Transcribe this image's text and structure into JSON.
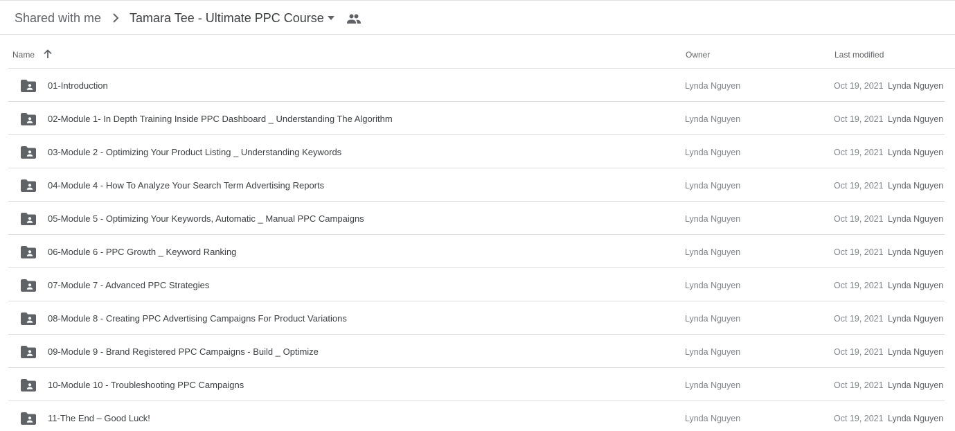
{
  "breadcrumb": {
    "root": "Shared with me",
    "current": "Tamara Tee - Ultimate PPC Course"
  },
  "columns": {
    "name": "Name",
    "owner": "Owner",
    "last_modified": "Last modified"
  },
  "colors": {
    "icon": "#5f6368",
    "divider": "#dadce0",
    "text": "#3c4043",
    "muted": "#80868b"
  },
  "icons": {
    "folder": "shared-folder-icon",
    "sort": "arrow-up-icon",
    "separator": "chevron-right-icon",
    "dropdown": "caret-down-icon",
    "shared": "people-icon"
  },
  "files": [
    {
      "name": "01-Introduction",
      "owner": "Lynda Nguyen",
      "date": "Oct 19, 2021",
      "by": "Lynda Nguyen"
    },
    {
      "name": "02-Module 1- In Depth Training Inside PPC Dashboard _ Understanding The Algorithm",
      "owner": "Lynda Nguyen",
      "date": "Oct 19, 2021",
      "by": "Lynda Nguyen"
    },
    {
      "name": "03-Module 2 - Optimizing Your Product Listing _ Understanding Keywords",
      "owner": "Lynda Nguyen",
      "date": "Oct 19, 2021",
      "by": "Lynda Nguyen"
    },
    {
      "name": "04-Module 4 - How To Analyze Your Search Term Advertising Reports",
      "owner": "Lynda Nguyen",
      "date": "Oct 19, 2021",
      "by": "Lynda Nguyen"
    },
    {
      "name": "05-Module 5 - Optimizing Your Keywords, Automatic _ Manual PPC Campaigns",
      "owner": "Lynda Nguyen",
      "date": "Oct 19, 2021",
      "by": "Lynda Nguyen"
    },
    {
      "name": "06-Module 6 - PPC Growth _ Keyword Ranking",
      "owner": "Lynda Nguyen",
      "date": "Oct 19, 2021",
      "by": "Lynda Nguyen"
    },
    {
      "name": "07-Module 7 - Advanced PPC Strategies",
      "owner": "Lynda Nguyen",
      "date": "Oct 19, 2021",
      "by": "Lynda Nguyen"
    },
    {
      "name": "08-Module 8 - Creating PPC Advertising Campaigns For Product Variations",
      "owner": "Lynda Nguyen",
      "date": "Oct 19, 2021",
      "by": "Lynda Nguyen"
    },
    {
      "name": "09-Module 9 - Brand Registered PPC Campaigns - Build _ Optimize",
      "owner": "Lynda Nguyen",
      "date": "Oct 19, 2021",
      "by": "Lynda Nguyen"
    },
    {
      "name": "10-Module 10 - Troubleshooting PPC Campaigns",
      "owner": "Lynda Nguyen",
      "date": "Oct 19, 2021",
      "by": "Lynda Nguyen"
    },
    {
      "name": "11-The End – Good Luck!",
      "owner": "Lynda Nguyen",
      "date": "Oct 19, 2021",
      "by": "Lynda Nguyen"
    }
  ]
}
